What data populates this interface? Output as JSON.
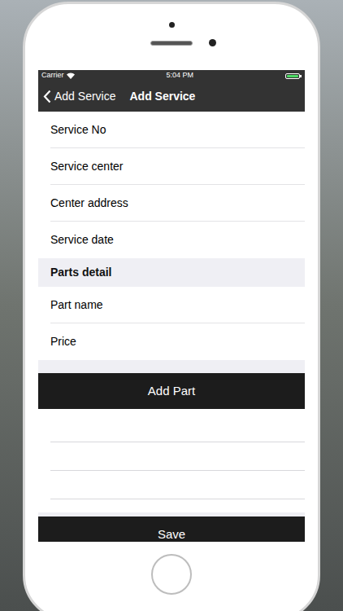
{
  "status_bar": {
    "carrier": "Carrier",
    "time": "5:04 PM",
    "battery_level": 1
  },
  "nav": {
    "back": "Add Service",
    "title": "Add Service"
  },
  "service_fields": [
    "Service No",
    "Service center",
    "Center address",
    "Service date"
  ],
  "section": "Parts detail",
  "part_fields": [
    "Part name",
    "Price"
  ],
  "add_button": "Add Part",
  "save_button": "Save"
}
